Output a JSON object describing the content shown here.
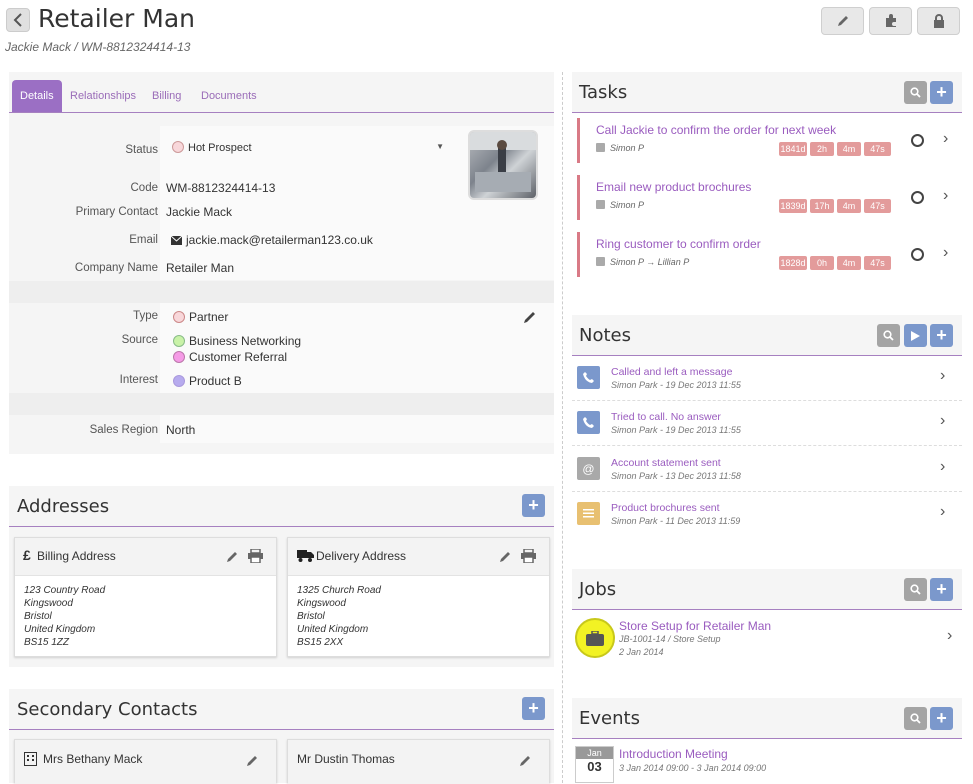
{
  "header": {
    "title": "Retailer Man",
    "subtitle": "Jackie Mack / WM-8812324414-13"
  },
  "tabs": [
    {
      "label": "Details"
    },
    {
      "label": "Relationships"
    },
    {
      "label": "Billing"
    },
    {
      "label": "Documents"
    }
  ],
  "details": {
    "status_label": "Status",
    "status_value": "Hot Prospect",
    "code_label": "Code",
    "code_value": "WM-8812324414-13",
    "primary_contact_label": "Primary Contact",
    "primary_contact_value": "Jackie Mack",
    "email_label": "Email",
    "email_value": "jackie.mack@retailerman123.co.uk",
    "company_label": "Company Name",
    "company_value": "Retailer Man",
    "type_label": "Type",
    "type_value": "Partner",
    "source_label": "Source",
    "source_values": [
      "Business Networking",
      "Customer Referral"
    ],
    "interest_label": "Interest",
    "interest_value": "Product B",
    "region_label": "Sales Region",
    "region_value": "North"
  },
  "addresses": {
    "title": "Addresses",
    "billing": {
      "title": "Billing Address",
      "lines": [
        "123 Country Road",
        "Kingswood",
        "Bristol",
        "United Kingdom",
        "BS15 1ZZ"
      ]
    },
    "delivery": {
      "title": "Delivery Address",
      "lines": [
        "1325 Church Road",
        "Kingswood",
        "Bristol",
        "United Kingdom",
        "BS15 2XX"
      ]
    }
  },
  "secondary_contacts": {
    "title": "Secondary Contacts",
    "contacts": [
      {
        "name": "Mrs Bethany Mack"
      },
      {
        "name": "Mr Dustin Thomas"
      }
    ]
  },
  "tasks": {
    "title": "Tasks",
    "items": [
      {
        "title": "Call Jackie to confirm the order for next week",
        "assignee": "Simon P",
        "badges": [
          "1841d",
          "2h",
          "4m",
          "47s"
        ]
      },
      {
        "title": "Email new product brochures",
        "assignee": "Simon P",
        "badges": [
          "1839d",
          "17h",
          "4m",
          "47s"
        ]
      },
      {
        "title": "Ring customer to confirm order",
        "assignee": "Simon P → Lillian P",
        "badges": [
          "1828d",
          "0h",
          "4m",
          "47s"
        ]
      }
    ]
  },
  "notes": {
    "title": "Notes",
    "items": [
      {
        "title": "Called and left a message",
        "meta": "Simon Park - 19 Dec 2013 11:55",
        "icon": "phone-icon",
        "color": "#7b98cc"
      },
      {
        "title": "Tried to call. No answer",
        "meta": "Simon Park - 19 Dec 2013 11:55",
        "icon": "phone-icon",
        "color": "#7b98cc"
      },
      {
        "title": "Account statement sent",
        "meta": "Simon Park - 13 Dec 2013 11:58",
        "icon": "at-icon",
        "color": "#a9a9a9"
      },
      {
        "title": "Product brochures sent",
        "meta": "Simon Park - 11 Dec 2013 11:59",
        "icon": "document-icon",
        "color": "#e8c071"
      }
    ]
  },
  "jobs": {
    "title": "Jobs",
    "items": [
      {
        "title": "Store Setup for Retailer Man",
        "meta": "JB-1001-14 / Store Setup",
        "date": "2 Jan 2014"
      }
    ]
  },
  "events": {
    "title": "Events",
    "items": [
      {
        "month": "Jan",
        "day": "03",
        "title": "Introduction Meeting",
        "meta": "3 Jan 2014 09:00 - 3 Jan 2014 09:00"
      }
    ]
  },
  "colors": {
    "accent": "#9b6fc4",
    "link": "#9a5cbf",
    "plus": "#7b98cc",
    "task_badge": "#e39b9b",
    "job_icon": "#f2f224"
  }
}
